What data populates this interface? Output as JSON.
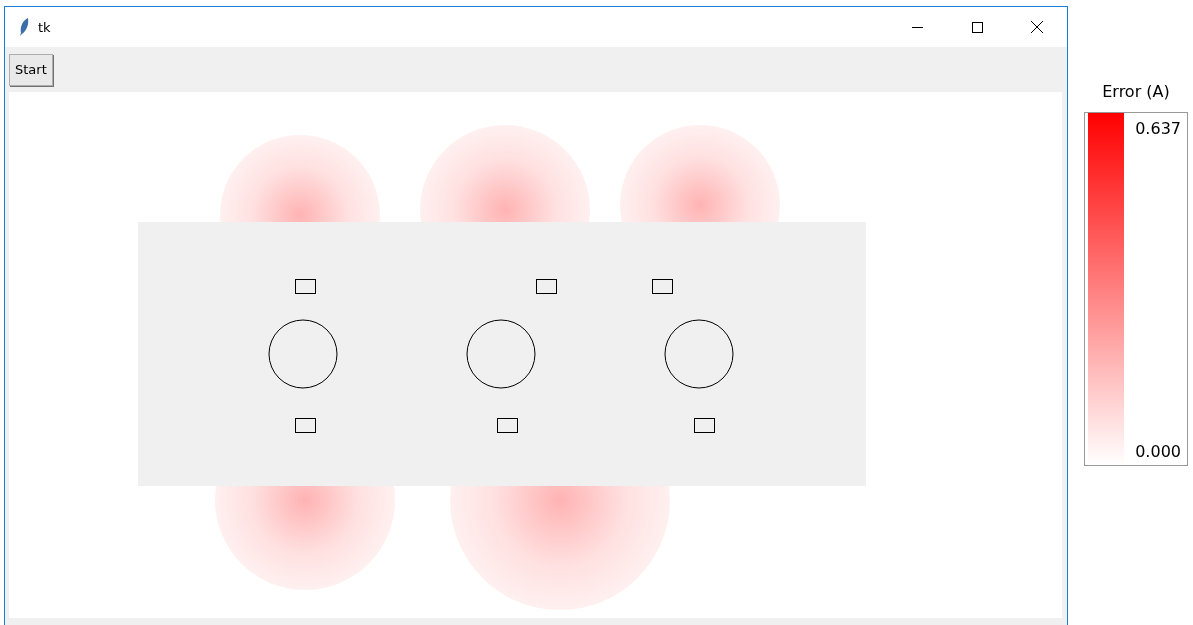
{
  "window": {
    "title": "tk"
  },
  "toolbar": {
    "buttons": [
      "Start"
    ]
  },
  "colorbar": {
    "title": "Error (A)",
    "max_label": "0.637",
    "min_label": "0.000"
  }
}
